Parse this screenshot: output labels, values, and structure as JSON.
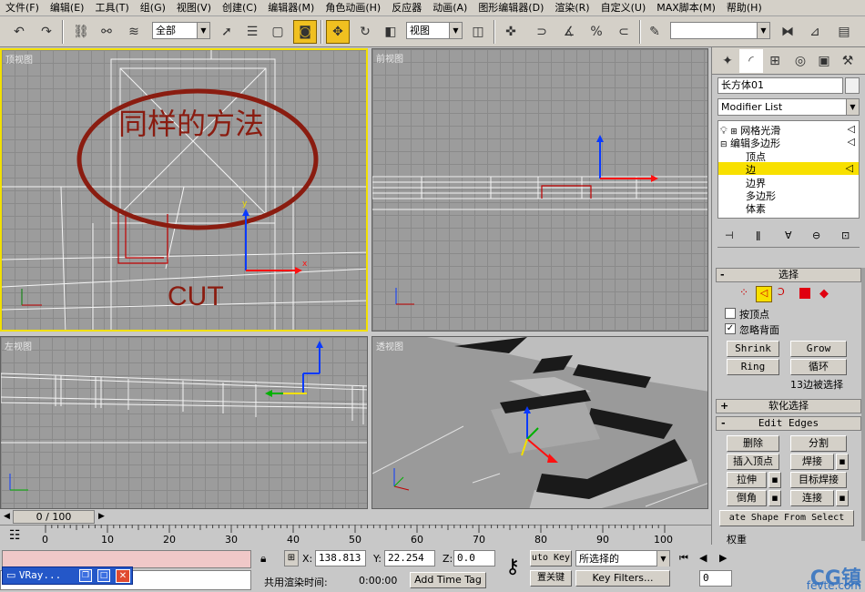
{
  "menu": [
    "文件(F)",
    "编辑(E)",
    "工具(T)",
    "组(G)",
    "视图(V)",
    "创建(C)",
    "编辑器(M)",
    "角色动画(H)",
    "反应器",
    "动画(A)",
    "图形编辑器(D)",
    "渲染(R)",
    "自定义(U)",
    "MAX脚本(M)",
    "帮助(H)"
  ],
  "toolbar": {
    "selection_filter": "全部",
    "coord_system": "视图"
  },
  "viewports": {
    "top_label": "顶视图",
    "front_label": "前视图",
    "left_label": "左视图",
    "persp_label": "透视图",
    "annotation_main": "同样的方法",
    "annotation_cut": "CUT",
    "axis_x": "x",
    "axis_y": "y"
  },
  "command_panel": {
    "object_name": "长方体01",
    "modifier_list": "Modifier List",
    "stack": [
      "网格光滑",
      "编辑多边形",
      "顶点",
      "边",
      "边界",
      "多边形",
      "体素"
    ],
    "stack_selected": "边",
    "selection_title": "选择",
    "by_vertex": "按顶点",
    "ignore_backface": "忽略背面",
    "shrink": "Shrink",
    "grow": "Grow",
    "ring": "Ring",
    "loop": "循环",
    "selected_info": "13边被选择",
    "soft_selection": "软化选择",
    "edit_edges": "Edit Edges",
    "remove": "删除",
    "split": "分割",
    "insert_vertex": "插入顶点",
    "weld": "焊接",
    "extrude": "拉伸",
    "target_weld": "目标焊接",
    "chamfer": "倒角",
    "connect": "连接",
    "create_shape": "ate Shape From Select",
    "weight": "权重"
  },
  "timeline": {
    "frame": "0 / 100",
    "ticks": [
      "0",
      "10",
      "20",
      "30",
      "40",
      "50",
      "60",
      "70",
      "80",
      "90",
      "100"
    ]
  },
  "status": {
    "x_label": "X:",
    "x_value": "138.813",
    "y_label": "Y:",
    "y_value": "22.254",
    "z_label": "Z:",
    "z_value": "0.0",
    "auto_key": "uto Key",
    "key_mode": "所选择的",
    "set_key": "置关键",
    "key_filters": "Key Filters...",
    "render_time_label": "共用渲染时间:",
    "render_time": "0:00:00",
    "add_time_tag": "Add Time Tag",
    "frame_field": "0",
    "taskbar_item": "VRay..."
  },
  "watermark": {
    "line1": "CG镇",
    "line2": "fevte.com"
  }
}
